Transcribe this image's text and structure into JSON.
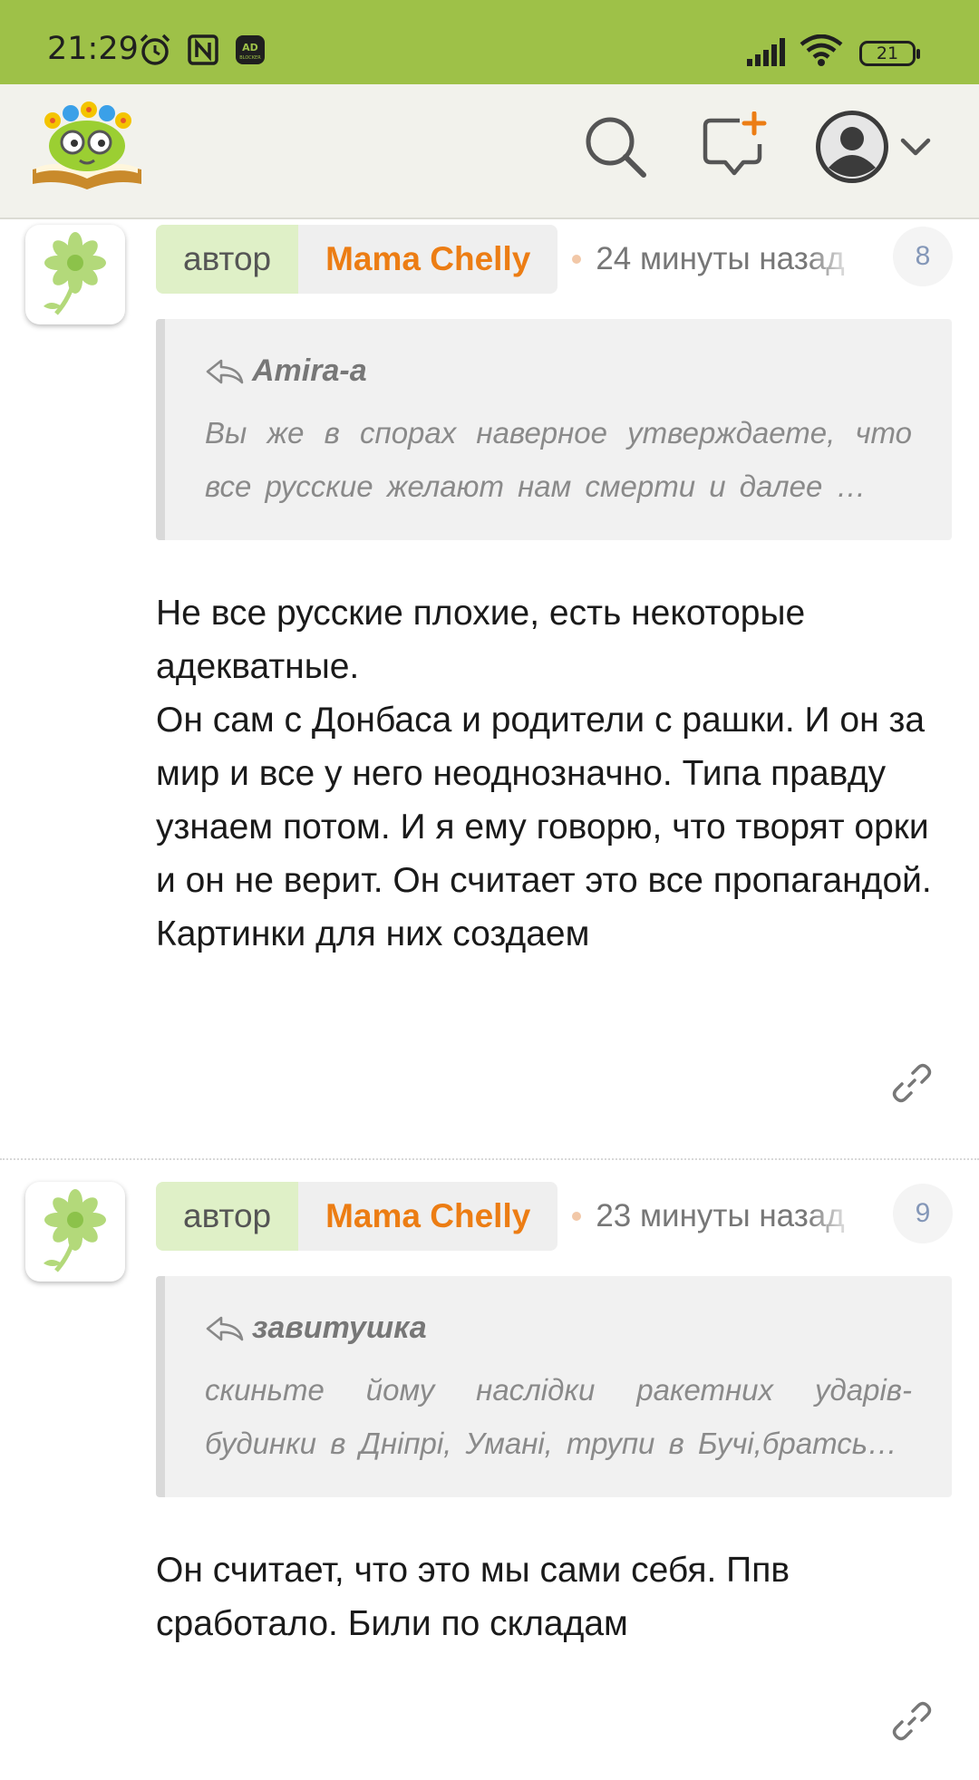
{
  "status_bar": {
    "time": "21:29",
    "battery": "21",
    "icons": [
      "alarm-icon",
      "nfc-icon",
      "ad-blocker-icon",
      "signal-icon",
      "wifi-icon",
      "battery-icon"
    ]
  },
  "header": {
    "icons": [
      "logo-icon",
      "search-icon",
      "new-topic-icon",
      "profile-avatar-icon",
      "chevron-down-icon"
    ]
  },
  "colors": {
    "status_bar": "#9ec148",
    "header_bg": "#f2f2ec",
    "author_badge_bg": "#dff0c7",
    "author_name": "#ec7d14",
    "quote_bg": "#f1f1f1",
    "post_number": "#8497b8"
  },
  "comments": [
    {
      "author_badge": "автор",
      "author_name": "Mama Chelly",
      "time": "24 минуты назад",
      "number": "8",
      "quote_author": "Amira-a",
      "quote_text": "Вы же в спорах наверное утверждаете, что все русские желают нам смерти и далее …",
      "body": "Не все русские плохие, есть некоторые адекватные.\nОн сам с Донбаса и родители с рашки. И он за мир и все у него неоднозначно. Типа правду узнаем потом. И я ему говорю, что творят орки и он не верит. Он считает это все пропагандой. Картинки для них создаем"
    },
    {
      "author_badge": "автор",
      "author_name": "Mama Chelly",
      "time": "23 минуты назад",
      "number": "9",
      "quote_author": "завитушка",
      "quote_text": "скиньте йому наслідки ракетних ударів- будинки в Дніпрі, Умані, трупи в Бучі,братсь…",
      "body": "Он считает, что это мы сами себя. Ппв сработало. Били по складам"
    }
  ]
}
